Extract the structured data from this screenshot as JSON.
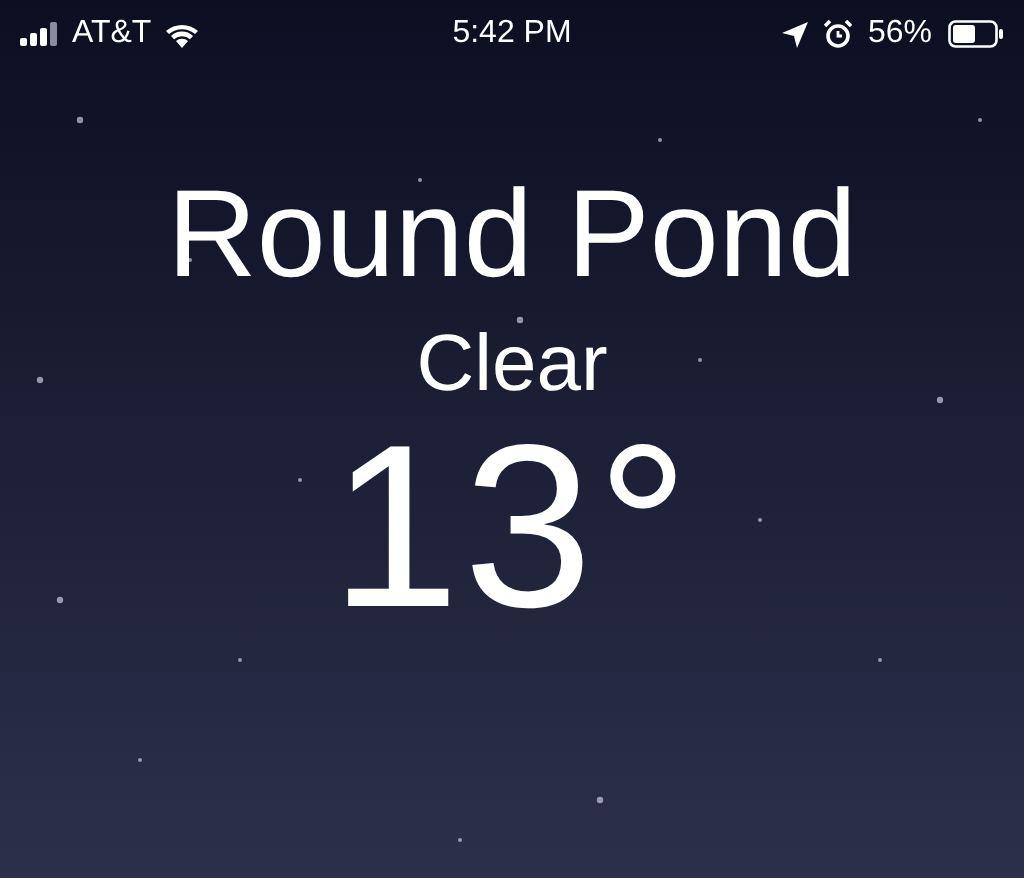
{
  "status_bar": {
    "carrier": "AT&T",
    "time": "5:42 PM",
    "battery": "56%"
  },
  "weather": {
    "location": "Round Pond",
    "condition": "Clear",
    "temperature": "13°"
  }
}
